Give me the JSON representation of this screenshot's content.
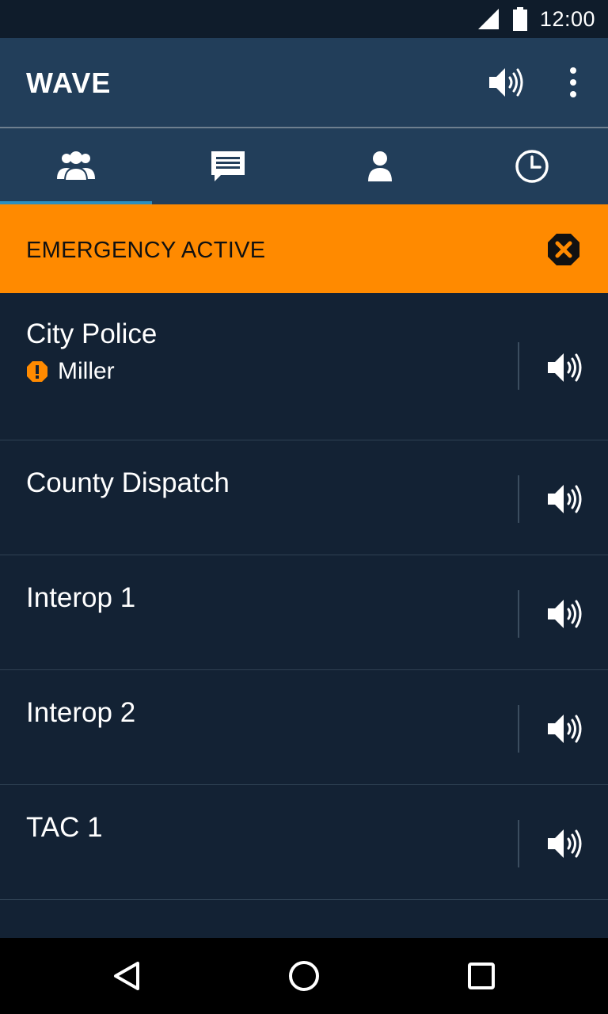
{
  "status_bar": {
    "time": "12:00",
    "icons": [
      "signal-icon",
      "battery-icon"
    ]
  },
  "app_bar": {
    "title": "WAVE",
    "actions": [
      "speaker-icon",
      "more-vert-icon"
    ]
  },
  "tabs": [
    {
      "icon": "groups-icon",
      "active": true
    },
    {
      "icon": "chat-icon",
      "active": false
    },
    {
      "icon": "person-icon",
      "active": false
    },
    {
      "icon": "history-clock-icon",
      "active": false
    }
  ],
  "banner": {
    "text": "EMERGENCY ACTIVE",
    "color": "#ff8a00"
  },
  "channels": [
    {
      "name": "City Police",
      "emergency_user": "Miller"
    },
    {
      "name": "County Dispatch"
    },
    {
      "name": "Interop 1"
    },
    {
      "name": "Interop 2"
    },
    {
      "name": "TAC 1"
    }
  ],
  "nav_bar": [
    "back-icon",
    "home-icon",
    "recents-icon"
  ],
  "colors": {
    "app_bar": "#223e5a",
    "background": "#132234",
    "tab_indicator": "#2d8fbf",
    "emergency": "#ff8a00"
  }
}
